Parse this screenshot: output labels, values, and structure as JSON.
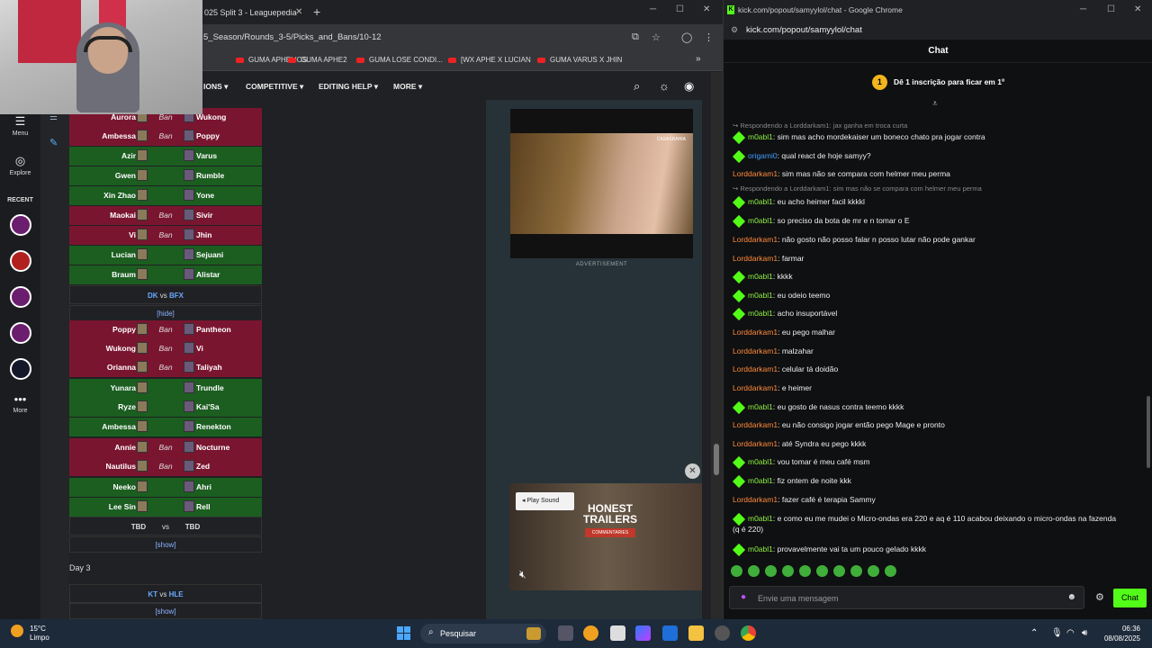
{
  "browser_left": {
    "tab_title": "025 Split 3 - Leaguepedia",
    "url": "5_Season/Rounds_3-5/Picks_and_Bans/10-12",
    "bookmarks": [
      "GUMA APHELIOS",
      "GUMA APHE2",
      "GUMA LOSE CONDI...",
      "[WX APHE X LUCIAN",
      "GUMA VARUS X JHIN"
    ],
    "nav": [
      "IONS",
      "COMPETITIVE",
      "EDITING HELP",
      "MORE"
    ]
  },
  "sidebar": {
    "menu_label": "Menu",
    "explore_label": "Explore",
    "recent_label": "RECENT",
    "more_label": "More"
  },
  "picks_game1": [
    {
      "left": "Aurora",
      "mid": "Ban",
      "right": "Wukong",
      "kind": "loss"
    },
    {
      "left": "Ambessa",
      "mid": "Ban",
      "right": "Poppy",
      "kind": "loss"
    },
    {
      "left": "Azir",
      "mid": "",
      "right": "Varus",
      "kind": "win"
    },
    {
      "left": "Gwen",
      "mid": "",
      "right": "Rumble",
      "kind": "win"
    },
    {
      "left": "Xin Zhao",
      "mid": "",
      "right": "Yone",
      "kind": "win"
    },
    {
      "left": "Maokai",
      "mid": "Ban",
      "right": "Sivir",
      "kind": "loss"
    },
    {
      "left": "Vi",
      "mid": "Ban",
      "right": "Jhin",
      "kind": "loss"
    },
    {
      "left": "Lucian",
      "mid": "",
      "right": "Sejuani",
      "kind": "win"
    },
    {
      "left": "Braum",
      "mid": "",
      "right": "Alistar",
      "kind": "win"
    }
  ],
  "match2": {
    "team_left": "DK",
    "vs": "vs",
    "team_right": "BFX"
  },
  "hide_link": "[hide]",
  "picks_game2": [
    {
      "left": "Poppy",
      "mid": "Ban",
      "right": "Pantheon",
      "kind": "loss"
    },
    {
      "left": "Wukong",
      "mid": "Ban",
      "right": "Vi",
      "kind": "loss"
    },
    {
      "left": "Orianna",
      "mid": "Ban",
      "right": "Taliyah",
      "kind": "loss"
    },
    {
      "left": "Yunara",
      "mid": "",
      "right": "Trundle",
      "kind": "win"
    },
    {
      "left": "Ryze",
      "mid": "",
      "right": "Kai'Sa",
      "kind": "win"
    },
    {
      "left": "Ambessa",
      "mid": "",
      "right": "Renekton",
      "kind": "win"
    },
    {
      "left": "Annie",
      "mid": "Ban",
      "right": "Nocturne",
      "kind": "loss"
    },
    {
      "left": "Nautilus",
      "mid": "Ban",
      "right": "Zed",
      "kind": "loss"
    },
    {
      "left": "Neeko",
      "mid": "",
      "right": "Ahri",
      "kind": "win"
    },
    {
      "left": "Lee Sin",
      "mid": "",
      "right": "Rell",
      "kind": "win"
    }
  ],
  "tbd_row": {
    "left": "TBD",
    "vs": "vs",
    "right": "TBD"
  },
  "show_link": "[show]",
  "day3": "Day 3",
  "match3": {
    "team_left": "KT",
    "vs": "vs",
    "team_right": "HLE"
  },
  "ad": {
    "label": "ADVERTISEMENT",
    "watermark": "CASASRAHIA",
    "play_sound": "Play Sound",
    "video_title": "HONEST TRAILERS",
    "video_sub": "COMMENTARIES"
  },
  "browser_right": {
    "title": "kick.com/popout/samyylol/chat - Google Chrome",
    "url": "kick.com/popout/samyylol/chat"
  },
  "chat": {
    "header": "Chat",
    "sub_banner": "Dê 1 inscrição para ficar em 1º",
    "sub_count": "1",
    "input_placeholder": "Envie uma mensagem",
    "send_label": "Chat",
    "messages": [
      {
        "type": "reply",
        "text": "↪ Respondendo a Lorddarkam1: jax ganha em troca curta"
      },
      {
        "type": "msg",
        "user": "m0abl1",
        "color": "green",
        "badge": true,
        "text": "sim mas acho mordekaiser um boneco chato pra jogar contra"
      },
      {
        "type": "msg",
        "user": "origami0",
        "color": "blue",
        "badge": true,
        "text": "qual react de hoje samyy?"
      },
      {
        "type": "msg",
        "user": "Lorddarkam1",
        "color": "orange",
        "badge": false,
        "text": "sim mas não se compara com helmer meu perma"
      },
      {
        "type": "reply",
        "text": "↪ Respondendo a Lorddarkam1: sim mas não se compara com helmer meu perma"
      },
      {
        "type": "msg",
        "user": "m0abl1",
        "color": "green",
        "badge": true,
        "text": "eu acho heimer facil kkkkl"
      },
      {
        "type": "msg",
        "user": "m0abl1",
        "color": "green",
        "badge": true,
        "text": "so preciso da bota de mr e n tomar o E"
      },
      {
        "type": "msg",
        "user": "Lorddarkam1",
        "color": "orange",
        "badge": false,
        "text": "não gosto não posso falar n posso lutar não pode gankar"
      },
      {
        "type": "msg",
        "user": "Lorddarkam1",
        "color": "orange",
        "badge": false,
        "text": "farmar"
      },
      {
        "type": "msg",
        "user": "m0abl1",
        "color": "green",
        "badge": true,
        "text": "kkkk"
      },
      {
        "type": "msg",
        "user": "m0abl1",
        "color": "green",
        "badge": true,
        "text": "eu odeio teemo"
      },
      {
        "type": "msg",
        "user": "m0abl1",
        "color": "green",
        "badge": true,
        "text": "acho insuportável"
      },
      {
        "type": "msg",
        "user": "Lorddarkam1",
        "color": "orange",
        "badge": false,
        "text": "eu pego malhar"
      },
      {
        "type": "msg",
        "user": "Lorddarkam1",
        "color": "orange",
        "badge": false,
        "text": "malzahar"
      },
      {
        "type": "msg",
        "user": "Lorddarkam1",
        "color": "orange",
        "badge": false,
        "text": "celular tá doidão"
      },
      {
        "type": "msg",
        "user": "Lorddarkam1",
        "color": "orange",
        "badge": false,
        "text": "e heimer"
      },
      {
        "type": "msg",
        "user": "m0abl1",
        "color": "green",
        "badge": true,
        "text": "eu gosto de nasus contra teemo kkkk"
      },
      {
        "type": "msg",
        "user": "Lorddarkam1",
        "color": "orange",
        "badge": false,
        "text": "eu não consigo jogar então pego Mage e pronto"
      },
      {
        "type": "msg",
        "user": "Lorddarkam1",
        "color": "orange",
        "badge": false,
        "text": "até Syndra eu pego kkkk"
      },
      {
        "type": "msg",
        "user": "m0abl1",
        "color": "green",
        "badge": true,
        "text": "vou tomar é meu café msm"
      },
      {
        "type": "msg",
        "user": "m0abl1",
        "color": "green",
        "badge": true,
        "text": "fiz ontem de noite kkk"
      },
      {
        "type": "msg",
        "user": "Lorddarkam1",
        "color": "orange",
        "badge": false,
        "text": "fazer café é terapia Sammy"
      },
      {
        "type": "msg2",
        "user": "m0abl1",
        "color": "green",
        "badge": true,
        "text": "e como eu me mudei o Micro-ondas era 220 e aq é 110 acabou deixando o micro-ondas na fazenda (q é 220)"
      },
      {
        "type": "msg",
        "user": "m0abl1",
        "color": "green",
        "badge": true,
        "text": "provavelmente vai ta um pouco gelado kkkk"
      }
    ]
  },
  "taskbar": {
    "temp": "15°C",
    "weather": "Limpo",
    "search": "Pesquisar",
    "time": "06:36",
    "date": "08/08/2025"
  },
  "colors": {
    "kick_green": "#53fc18",
    "win_row": "#1b5e20",
    "loss_row": "#7a1530"
  }
}
